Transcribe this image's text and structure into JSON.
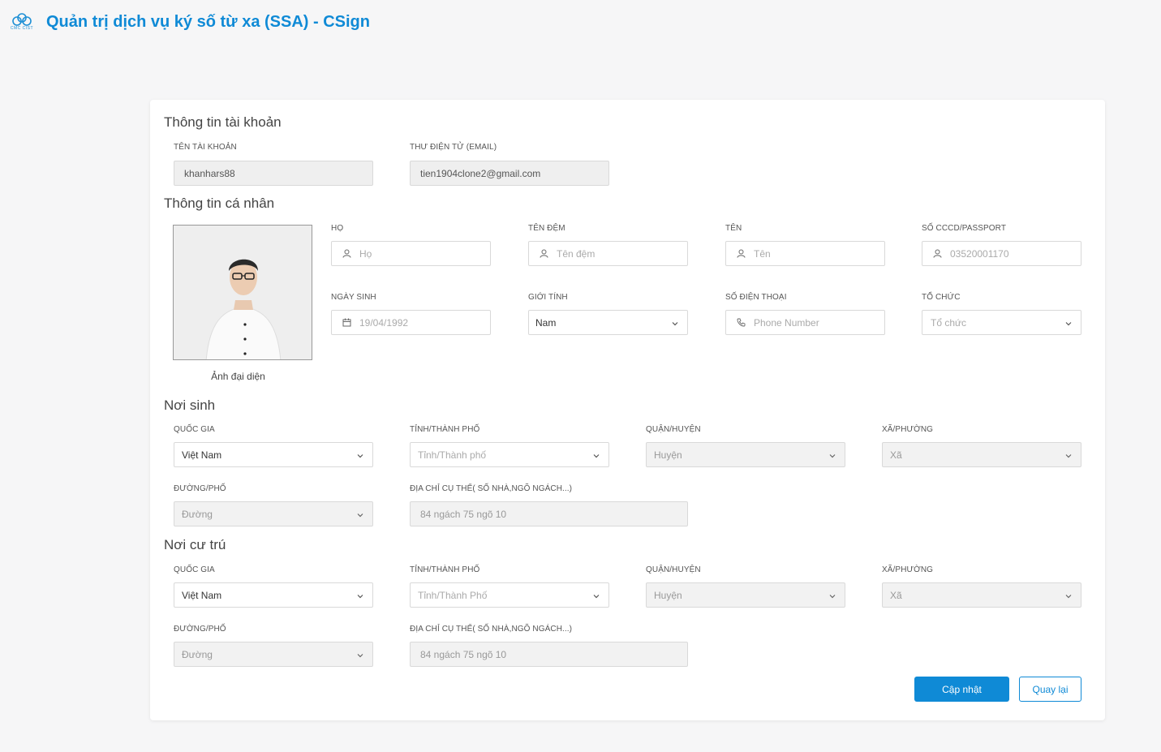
{
  "app": {
    "title": "Quản trị dịch vụ ký số từ xa (SSA) - CSign",
    "logo_text": "CMC CIST",
    "accent": "#0f8ad6"
  },
  "account": {
    "title": "Thông tin tài khoản",
    "username_label": "TÊN TÀI KHOẢN",
    "username_value": "khanhars88",
    "email_label": "THƯ ĐIỆN TỬ (EMAIL)",
    "email_value": "tien1904clone2@gmail.com"
  },
  "personal": {
    "title": "Thông tin cá nhân",
    "avatar_caption": "Ảnh đại diện",
    "ho_label": "HỌ",
    "ho_placeholder": "Họ",
    "tendem_label": "TÊN ĐỆM",
    "tendem_placeholder": "Tên đệm",
    "ten_label": "TÊN",
    "ten_placeholder": "Tên",
    "cccd_label": "SỐ CCCD/PASSPORT",
    "cccd_value": "03520001170",
    "dob_label": "NGÀY SINH",
    "dob_value": "19/04/1992",
    "gender_label": "GIỚI TÍNH",
    "gender_value": "Nam",
    "phone_label": "SỐ ĐIỆN THOẠI",
    "phone_placeholder": "Phone Number",
    "org_label": "TỔ CHỨC",
    "org_placeholder": "Tổ chức"
  },
  "birthplace": {
    "title": "Nơi sinh",
    "country_label": "QUỐC GIA",
    "country_value": "Việt Nam",
    "province_label": "TỈNH/THÀNH PHỐ",
    "province_placeholder": "Tỉnh/Thành phố",
    "district_label": "QUẬN/HUYỆN",
    "district_placeholder": "Huyện",
    "ward_label": "XÃ/PHƯỜNG",
    "ward_placeholder": "Xã",
    "street_label": "ĐƯỜNG/PHỐ",
    "street_placeholder": "Đường",
    "address_label": "ĐỊA CHỈ CỤ THỂ( SỐ NHÀ,NGÕ NGÁCH...)",
    "address_value": "84 ngách 75 ngõ 10"
  },
  "residence": {
    "title": "Nơi cư trú",
    "country_label": "QUỐC GIA",
    "country_value": "Việt Nam",
    "province_label": "TỈNH/THÀNH PHỐ",
    "province_placeholder": "Tỉnh/Thành Phố",
    "district_label": "QUẬN/HUYỆN",
    "district_placeholder": "Huyện",
    "ward_label": "XÃ/PHƯỜNG",
    "ward_placeholder": "Xã",
    "street_label": "ĐƯỜNG/PHỐ",
    "street_placeholder": "Đường",
    "address_label": "ĐỊA CHỈ CỤ THỂ( SỐ NHÀ,NGÕ NGÁCH...)",
    "address_value": "84 ngách 75 ngõ 10"
  },
  "actions": {
    "update_label": "Cập nhật",
    "back_label": "Quay lại"
  }
}
